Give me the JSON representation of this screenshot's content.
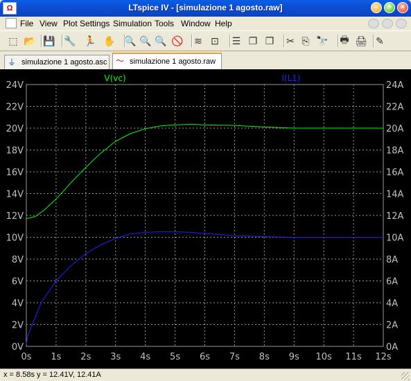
{
  "window": {
    "title": "LTspice IV - [simulazione 1 agosto.raw]"
  },
  "menu": [
    "File",
    "View",
    "Plot Settings",
    "Simulation",
    "Tools",
    "Window",
    "Help"
  ],
  "toolbar": [
    {
      "icon": "schematic-icon",
      "glyph": "⬚"
    },
    {
      "icon": "open-icon",
      "glyph": "📂"
    },
    {
      "icon": "save-icon",
      "glyph": "💾"
    },
    {
      "icon": "control-panel-icon",
      "glyph": "🔧"
    },
    {
      "icon": "run-icon",
      "glyph": "🏃"
    },
    {
      "icon": "pan-hand-icon",
      "glyph": "✋"
    },
    {
      "icon": "zoom-in-icon",
      "glyph": "🔍"
    },
    {
      "icon": "zoom-area-icon",
      "glyph": "🔍"
    },
    {
      "icon": "zoom-out-icon",
      "glyph": "🔍"
    },
    {
      "icon": "zoom-cancel-icon",
      "glyph": "🚫"
    },
    {
      "icon": "autorange-icon",
      "glyph": "≋"
    },
    {
      "icon": "fit-icon",
      "glyph": "⊡"
    },
    {
      "icon": "tile-horizontal-icon",
      "glyph": "☰"
    },
    {
      "icon": "cascade-icon",
      "glyph": "❐"
    },
    {
      "icon": "cascade-alt-icon",
      "glyph": "❐"
    },
    {
      "icon": "cut-icon",
      "glyph": "✂"
    },
    {
      "icon": "copy-icon",
      "glyph": "⎘"
    },
    {
      "icon": "find-icon",
      "glyph": "🔭"
    },
    {
      "icon": "print-preview-icon",
      "glyph": "🖶"
    },
    {
      "icon": "print-icon",
      "glyph": "🖨"
    },
    {
      "icon": "pencil-icon",
      "glyph": "✎"
    }
  ],
  "tabs": [
    {
      "label": "simulazione 1 agosto.asc",
      "active": false,
      "icon": "schematic-tab-icon"
    },
    {
      "label": "simulazione 1 agosto.raw",
      "active": true,
      "icon": "waveform-tab-icon"
    }
  ],
  "status": "x = 8.58s    y = 12.41V, 12.41A",
  "colors": {
    "trace_vc": "#00FF00",
    "trace_il": "#2020FF",
    "grid": "#999999",
    "axis_text": "#C0C0C0",
    "plot_bg": "#000000"
  },
  "chart_data": {
    "type": "line",
    "xlabel": "",
    "ylabel_left": "",
    "ylabel_right": "",
    "xlim": [
      0,
      12
    ],
    "ylim_left": [
      0,
      24
    ],
    "ylim_right": [
      0,
      24
    ],
    "x_ticks": [
      "0s",
      "1s",
      "2s",
      "3s",
      "4s",
      "5s",
      "6s",
      "7s",
      "8s",
      "9s",
      "10s",
      "11s",
      "12s"
    ],
    "y_left_ticks": [
      "0V",
      "2V",
      "4V",
      "6V",
      "8V",
      "10V",
      "12V",
      "14V",
      "16V",
      "18V",
      "20V",
      "22V",
      "24V"
    ],
    "y_right_ticks": [
      "0A",
      "2A",
      "4A",
      "6A",
      "8A",
      "10A",
      "12A",
      "14A",
      "16A",
      "18A",
      "20A",
      "22A",
      "24A"
    ],
    "grid": true,
    "series": [
      {
        "name": "V(vc)",
        "axis": "left",
        "x": [
          0,
          0.3,
          0.6,
          1,
          1.5,
          2,
          2.5,
          3,
          3.5,
          4,
          4.5,
          5,
          5.5,
          6,
          7,
          8,
          9,
          10,
          11,
          12
        ],
        "y": [
          11.7,
          11.9,
          12.5,
          13.5,
          15.0,
          16.4,
          17.7,
          18.8,
          19.5,
          19.95,
          20.2,
          20.3,
          20.35,
          20.3,
          20.25,
          20.1,
          20.0,
          20.0,
          20.0,
          20.0
        ]
      },
      {
        "name": "I(L1)",
        "axis": "right",
        "x": [
          0,
          0.05,
          0.5,
          1,
          1.5,
          2,
          2.5,
          3,
          3.5,
          4,
          4.5,
          5,
          5.5,
          6,
          7,
          8,
          9,
          10,
          11,
          12
        ],
        "y": [
          0.2,
          1.0,
          4.0,
          6.0,
          7.4,
          8.5,
          9.3,
          9.9,
          10.3,
          10.45,
          10.5,
          10.5,
          10.45,
          10.35,
          10.15,
          10.05,
          10.0,
          10.0,
          10.0,
          10.0
        ]
      }
    ]
  }
}
